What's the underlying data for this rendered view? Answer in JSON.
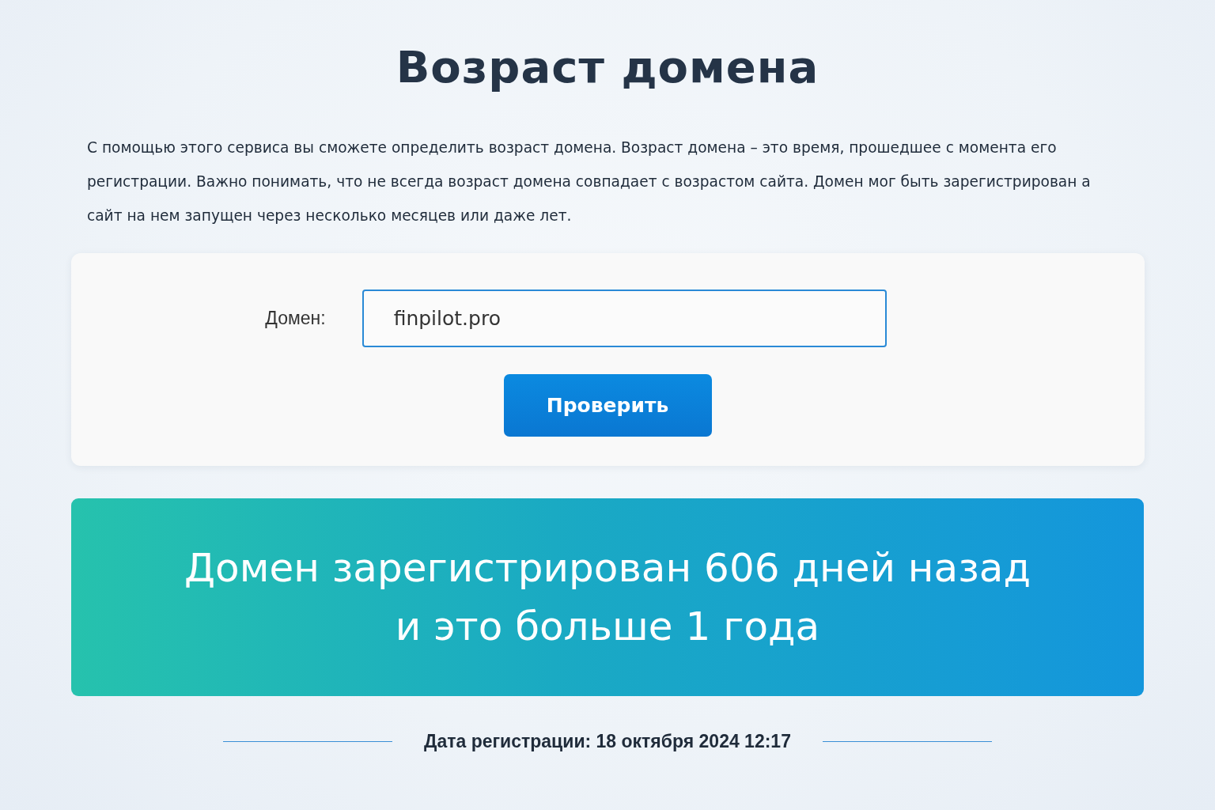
{
  "title": "Возраст домена",
  "description": "С помощью этого сервиса вы сможете определить возраст домена. Возраст домена – это время, прошедшее с момента его регистрации. Важно понимать, что не всегда возраст домена совпадает с возрастом сайта. Домен мог быть зарегистрирован а сайт на нем запущен через несколько месяцев или даже лет.",
  "form": {
    "label": "Домен:",
    "value": "finpilot.pro",
    "button": "Проверить"
  },
  "result": {
    "lines": [
      "Домен зарегистрирован 606 дней назад",
      "и это больше 1 года"
    ]
  },
  "registration_date": "Дата регистрации: 18 октября 2024 12:17"
}
